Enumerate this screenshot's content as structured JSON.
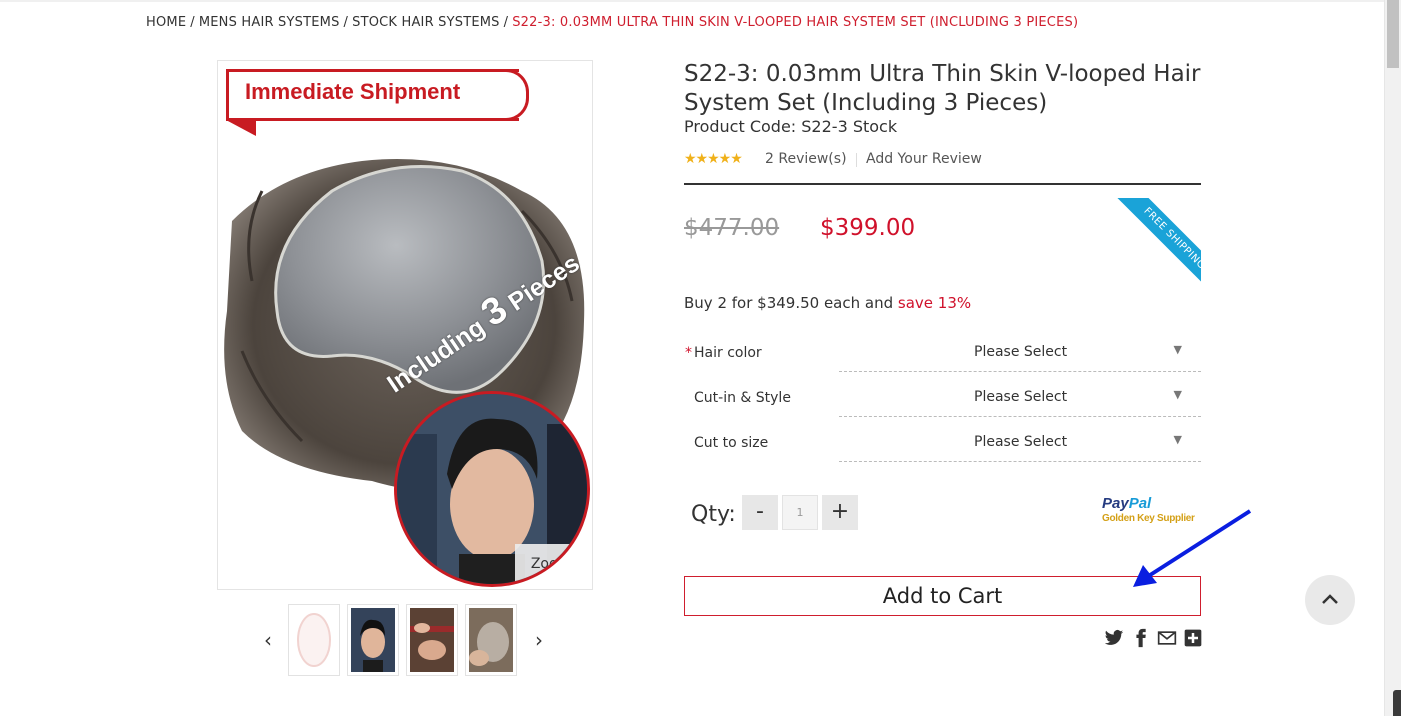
{
  "breadcrumb": {
    "home": "HOME",
    "level1": "MENS HAIR SYSTEMS",
    "level2": "STOCK HAIR SYSTEMS",
    "current": "S22-3: 0.03MM ULTRA THIN SKIN V-LOOPED HAIR SYSTEM SET (INCLUDING 3 PIECES)",
    "separator": "/"
  },
  "gallery": {
    "banner_text": "Immediate Shipment",
    "overlay_text_small": "Including",
    "overlay_number": "3",
    "overlay_text_end": "Pieces",
    "zoom_label": "Zoom",
    "prev_arrow": "‹",
    "next_arrow": "›"
  },
  "product": {
    "title": "S22-3: 0.03mm Ultra Thin Skin V-looped Hair System Set (Including 3 Pieces)",
    "code": "Product Code: S22-3 Stock",
    "stars": "★★★★★",
    "rating": 5,
    "reviews_label": "2 Review(s)",
    "add_review_label": "Add Your Review",
    "old_price": "$477.00",
    "price": "$399.00",
    "ribbon": "FREE SHIPPING",
    "bulk_offer": "Buy 2 for $349.50 each and",
    "bulk_save": "save 13%"
  },
  "options": [
    {
      "label": "Hair color",
      "required": "*",
      "value": "Please Select",
      "arrow": "▼"
    },
    {
      "label": "Cut-in & Style",
      "required": "",
      "value": "Please Select",
      "arrow": "▼"
    },
    {
      "label": "Cut to size",
      "required": "",
      "value": "Please Select",
      "arrow": "▼"
    }
  ],
  "quantity": {
    "label": "Qty:",
    "minus": "-",
    "plus": "+",
    "value": "1"
  },
  "paypal": {
    "pay": "Pay",
    "pal": "Pal",
    "tagline": "Golden Key Supplier"
  },
  "cart": {
    "add_to_cart_label": "Add to Cart"
  },
  "colors": {
    "accent_red": "#cf1e2e",
    "price_red": "#d0112b",
    "ribbon_blue": "#1aa3d8",
    "annotation_blue": "#0a1ee0"
  },
  "icons": [
    "twitter-icon",
    "facebook-icon",
    "email-icon",
    "share-plus-icon",
    "chevron-up-icon"
  ]
}
